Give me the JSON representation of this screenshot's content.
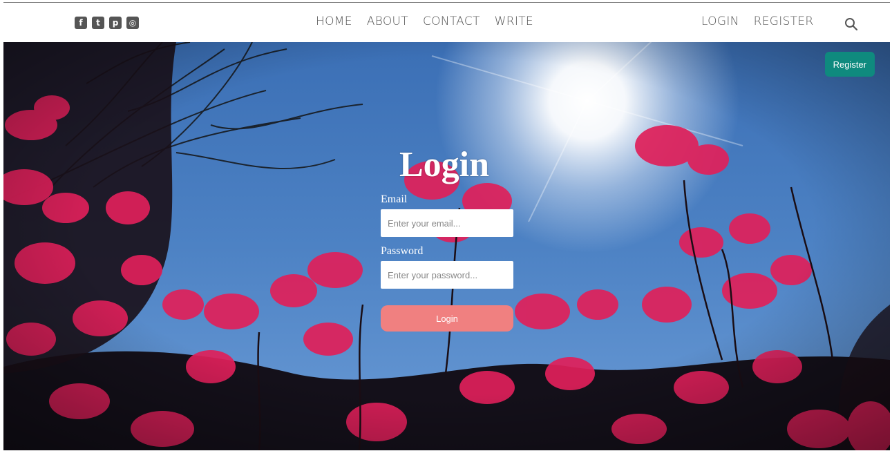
{
  "social": {
    "icons": [
      {
        "name": "facebook-icon",
        "glyph": "f"
      },
      {
        "name": "twitter-icon",
        "glyph": "t"
      },
      {
        "name": "pinterest-icon",
        "glyph": "p"
      },
      {
        "name": "instagram-icon",
        "glyph": "◎"
      }
    ]
  },
  "nav": {
    "home": "HOME",
    "about": "ABOUT",
    "contact": "CONTACT",
    "write": "WRITE",
    "login": "LOGIN",
    "register": "REGISTER",
    "search_icon": "search-icon"
  },
  "hero": {
    "register_button": "Register",
    "register_color": "#0f8a7e"
  },
  "login_form": {
    "title": "Login",
    "email_label": "Email",
    "email_placeholder": "Enter your email...",
    "email_value": "",
    "password_label": "Password",
    "password_placeholder": "Enter your password...",
    "password_value": "",
    "submit_label": "Login",
    "submit_color": "#f08080"
  }
}
